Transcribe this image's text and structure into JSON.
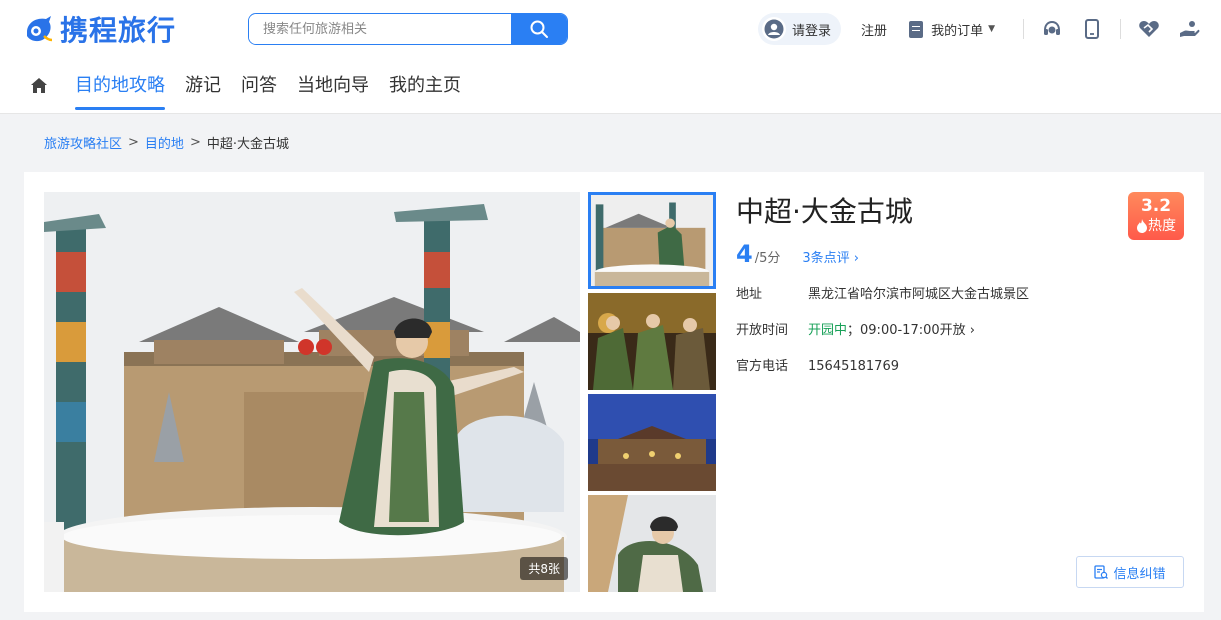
{
  "header": {
    "brand": "携程旅行",
    "search_placeholder": "搜索任何旅游相关",
    "login_label": "请登录",
    "register_label": "注册",
    "orders_label": "我的订单"
  },
  "nav": {
    "items": [
      "目的地攻略",
      "游记",
      "问答",
      "当地向导",
      "我的主页"
    ]
  },
  "breadcrumb": {
    "items": [
      "旅游攻略社区",
      "目的地"
    ],
    "current": "中超·大金古城"
  },
  "poi": {
    "name": "中超·大金古城",
    "score": "4",
    "score_unit": "/5分",
    "reviews": "3条点评 ›",
    "heat_value": "3.2",
    "heat_label": "热度",
    "address_label": "地址",
    "address": "黑龙江省哈尔滨市阿城区大金古城景区",
    "hours_label": "开放时间",
    "open_status": "开园中",
    "hours": "；09:00-17:00开放 ›",
    "phone_label": "官方电话",
    "phone": "15645181769",
    "photo_count": "共8张",
    "report_label": "信息纠错"
  },
  "colors": {
    "primary": "#2a7ff3",
    "open_green": "#18a058",
    "heat_orange": "#ff6a4d"
  }
}
